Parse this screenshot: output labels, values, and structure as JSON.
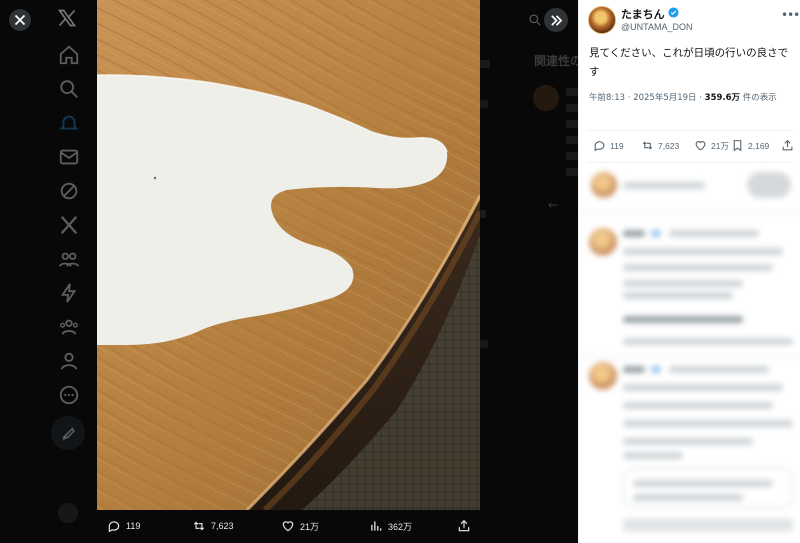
{
  "viewer": {
    "close_label": "Close",
    "expand_label": "Expand",
    "background": {
      "related_heading": "関連性の"
    },
    "media": {
      "description": "",
      "actions": [
        {
          "icon": "reply-icon",
          "count": "119"
        },
        {
          "icon": "retweet-icon",
          "count": "7,623"
        },
        {
          "icon": "like-icon",
          "count": "21万"
        },
        {
          "icon": "views-icon",
          "count": "362万"
        },
        {
          "icon": "share-icon",
          "count": ""
        }
      ]
    }
  },
  "post": {
    "author": {
      "display_name": "たまちん",
      "verified": true,
      "handle": "@UNTAMA_DON"
    },
    "text": "見てください、これが日頃の行いの良さです",
    "timestamp": "午前8:13 · 2025年5月19日 · ",
    "views_count": "359.6万",
    "views_label": " 件の表示",
    "actions": {
      "replies": "119",
      "retweets": "7,623",
      "likes": "21万",
      "bookmarks": "2,169"
    }
  },
  "colors": {
    "accent": "#1d9bf0",
    "panel_bg": "#ffffff",
    "backdrop_bg": "#000000",
    "wood": "#b07b43",
    "milk": "#eeeeea"
  }
}
